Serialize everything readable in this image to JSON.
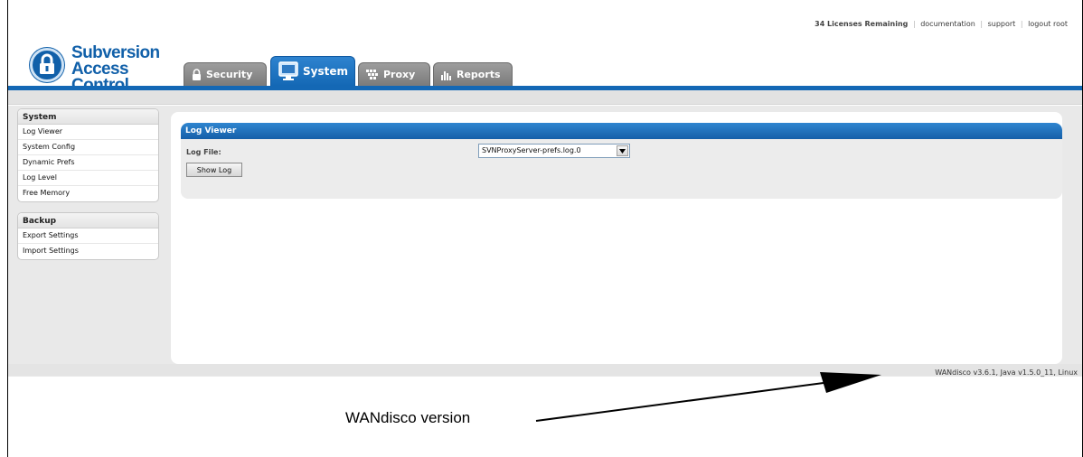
{
  "top_links": {
    "licenses": "34 Licenses Remaining",
    "documentation": "documentation",
    "support": "support",
    "logout": "logout root",
    "separator": "|"
  },
  "logo": {
    "line1": "Subversion",
    "line2": "Access Control"
  },
  "tabs": [
    {
      "label": "Security",
      "icon": "lock-icon",
      "active": false
    },
    {
      "label": "System",
      "icon": "monitor-icon",
      "active": true
    },
    {
      "label": "Proxy",
      "icon": "proxy-grid-icon",
      "active": false
    },
    {
      "label": "Reports",
      "icon": "bar-chart-icon",
      "active": false
    }
  ],
  "sidebar": {
    "sections": [
      {
        "title": "System",
        "items": [
          "Log Viewer",
          "System Config",
          "Dynamic Prefs",
          "Log Level",
          "Free Memory"
        ]
      },
      {
        "title": "Backup",
        "items": [
          "Export Settings",
          "Import Settings"
        ]
      }
    ]
  },
  "log_viewer": {
    "title": "Log Viewer",
    "log_file_label": "Log File:",
    "log_file_value": "SVNProxyServer-prefs.log.0",
    "show_log_label": "Show Log"
  },
  "footer": {
    "version": "WANdisco v3.6.1, Java v1.5.0_11, Linux"
  },
  "annotation": {
    "text": "WANdisco version"
  },
  "colors": {
    "brand_blue": "#1468b5",
    "tab_grey": "#8a8a8a",
    "background_grey": "#e9e9e9"
  }
}
